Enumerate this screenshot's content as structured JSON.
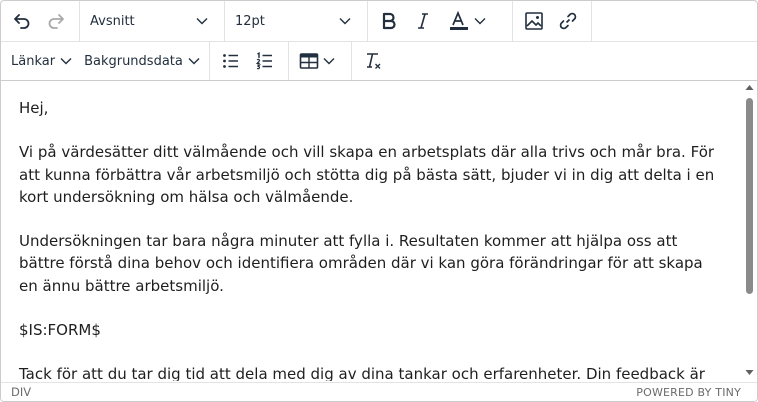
{
  "toolbar": {
    "undo_icon": "undo-icon",
    "redo_icon": "redo-icon",
    "block_format": "Avsnitt",
    "font_size": "12pt",
    "bold_icon": "bold-icon",
    "italic_icon": "italic-icon",
    "text_color_icon": "text-color-icon",
    "text_color": "#222f3e",
    "image_icon": "image-icon",
    "link_icon": "link-icon",
    "links_menu": "Länkar",
    "background_menu": "Bakgrundsdata",
    "bullet_list_icon": "bullet-list-icon",
    "numbered_list_icon": "numbered-list-icon",
    "table_icon": "table-icon",
    "clear_format_icon": "clear-formatting-icon"
  },
  "content": {
    "paragraphs": [
      "Hej,",
      "Vi på värdesätter ditt välmående och vill skapa en arbetsplats där alla trivs och mår bra. För att kunna förbättra vår arbetsmiljö och stötta dig på bästa sätt, bjuder vi in dig att delta i en kort undersökning om hälsa och välmående.",
      "Undersökningen tar bara några minuter att fylla i. Resultaten kommer att hjälpa oss att bättre förstå dina behov och identifiera områden där vi kan göra förändringar för att skapa en ännu bättre arbetsmiljö.",
      "$IS:FORM$",
      "Tack för att du tar dig tid att dela med dig av dina tankar och erfarenheter. Din feedback är viktig för"
    ]
  },
  "statusbar": {
    "path": "DIV",
    "branding": "POWERED BY TINY"
  }
}
